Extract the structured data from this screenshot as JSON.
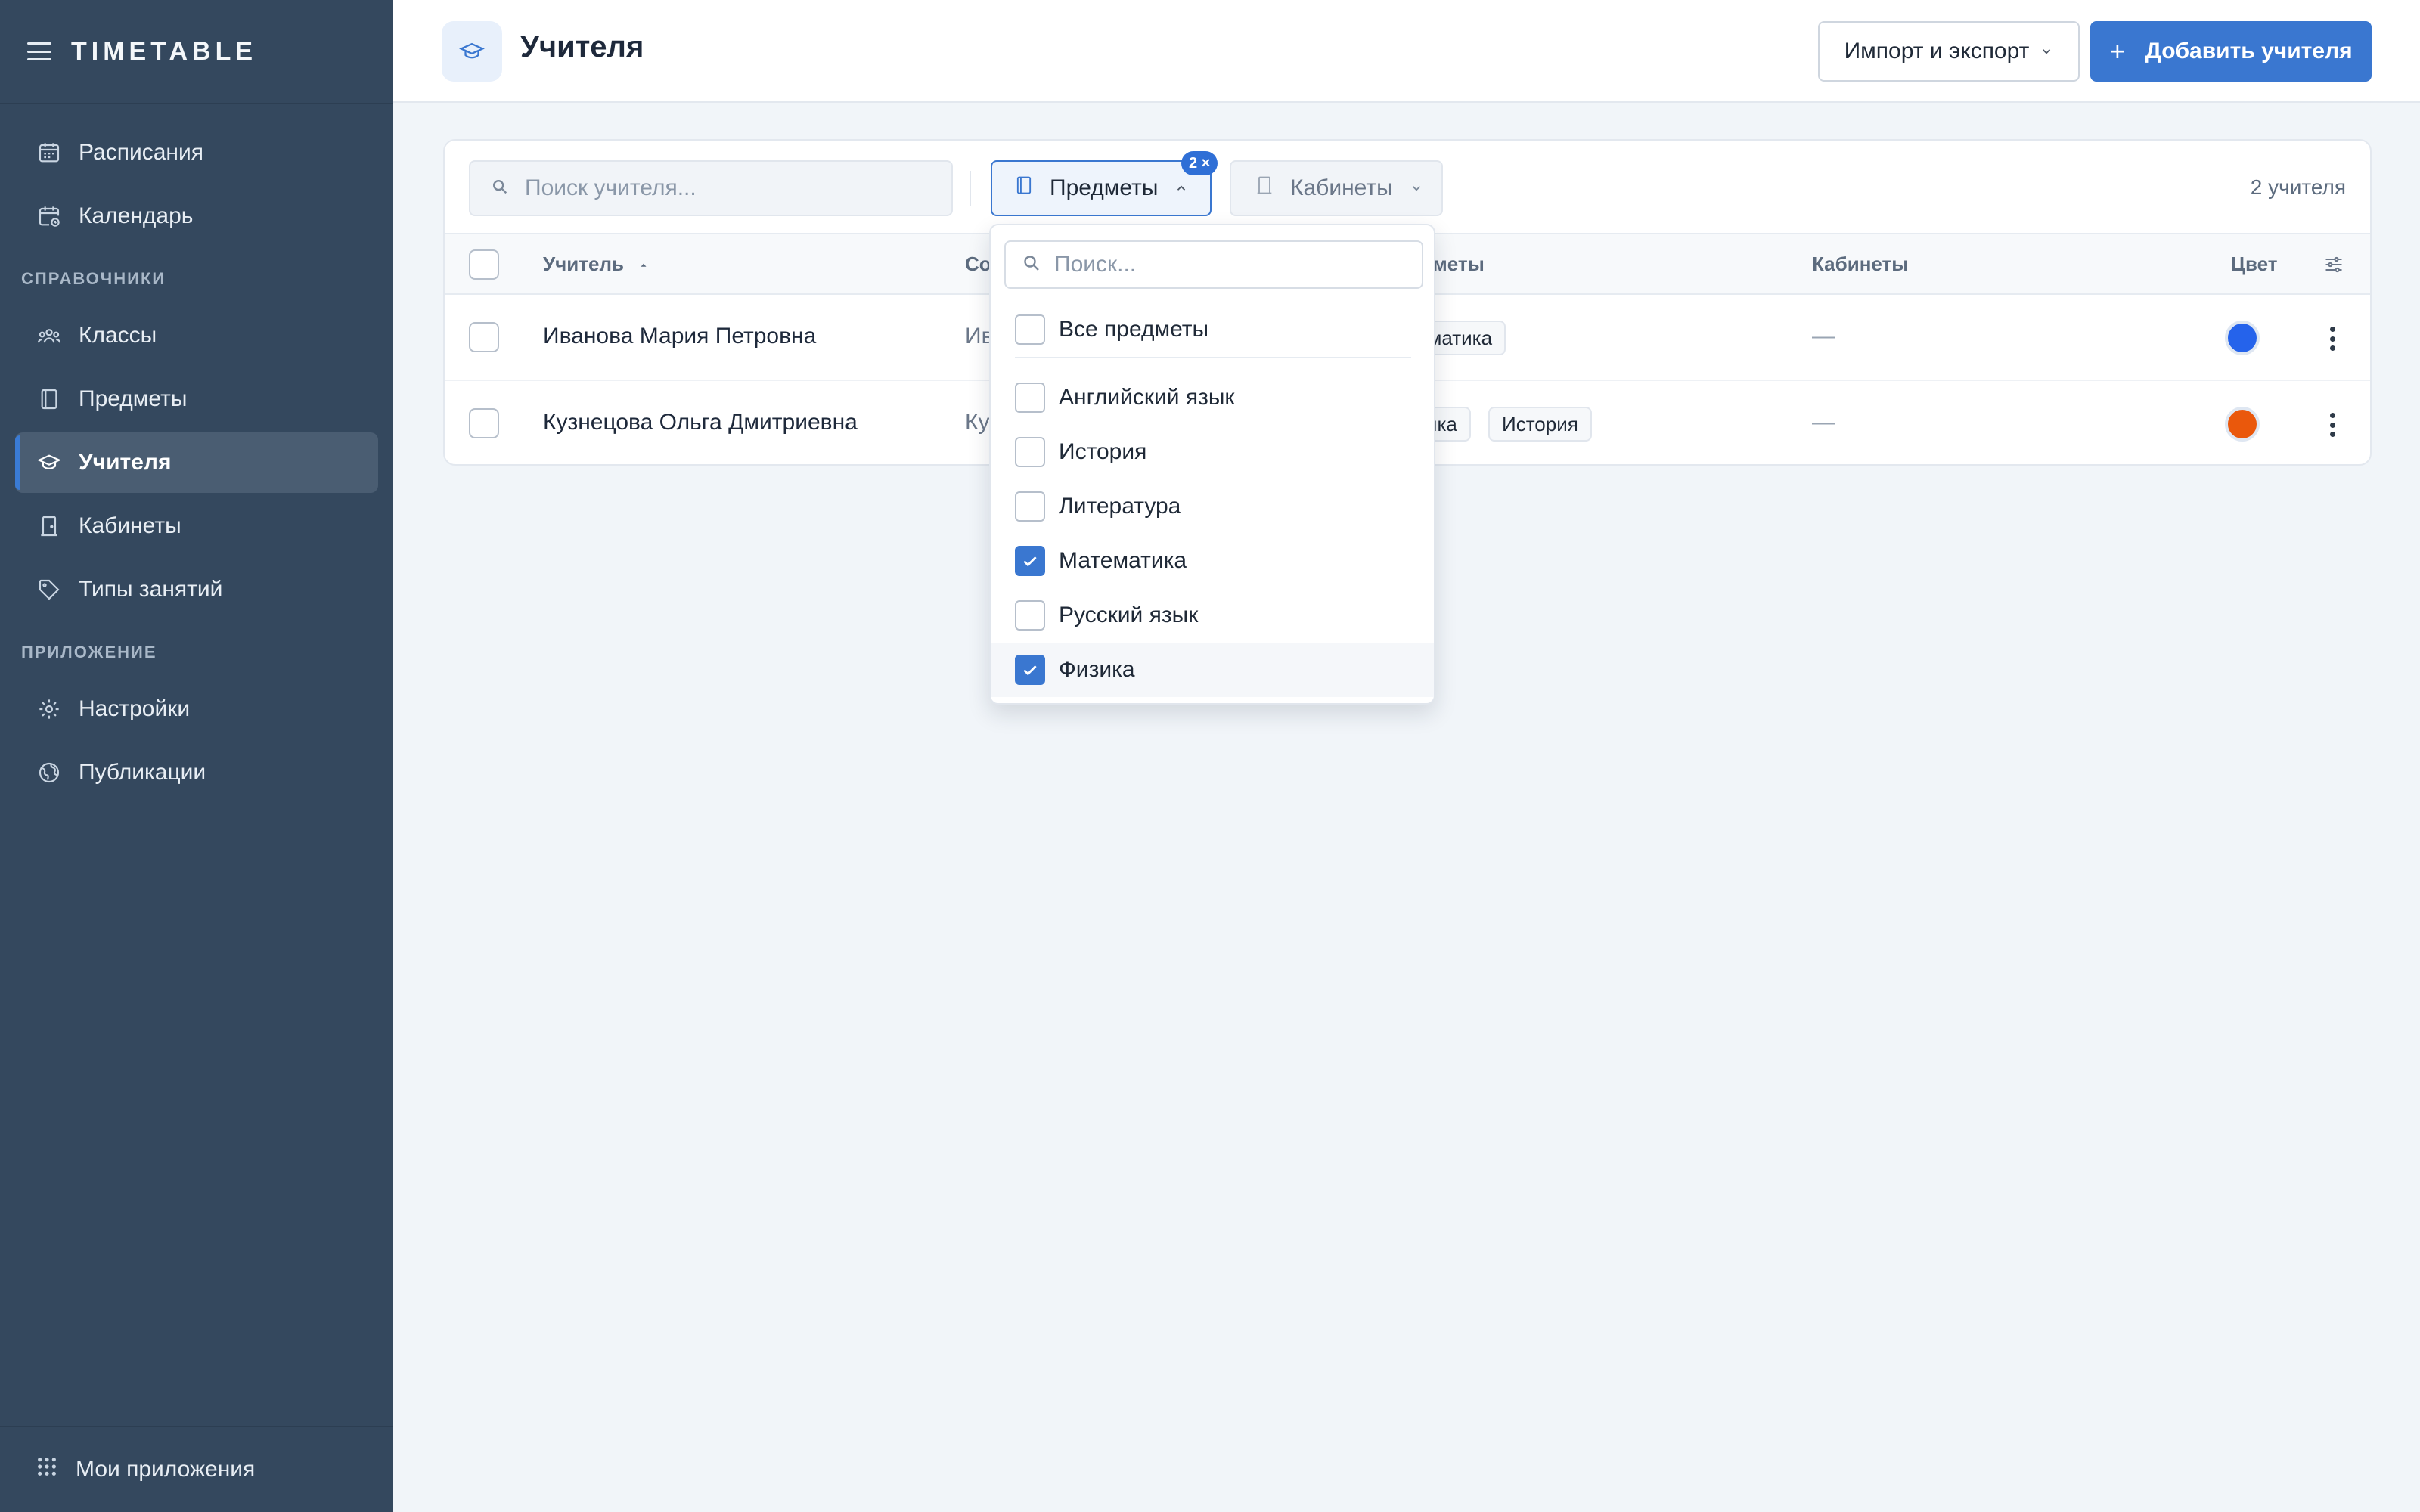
{
  "brand": {
    "name": "TIMETABLE"
  },
  "sidebar": {
    "items_top": [
      {
        "label": "Расписания",
        "icon": "calendar-grid-icon"
      },
      {
        "label": "Календарь",
        "icon": "calendar-clock-icon"
      }
    ],
    "section_refs": "СПРАВОЧНИКИ",
    "items_refs": [
      {
        "label": "Классы",
        "icon": "group-icon"
      },
      {
        "label": "Предметы",
        "icon": "book-icon"
      },
      {
        "label": "Учителя",
        "icon": "graduation-cap-icon",
        "active": true
      },
      {
        "label": "Кабинеты",
        "icon": "door-icon"
      },
      {
        "label": "Типы занятий",
        "icon": "tag-icon"
      }
    ],
    "section_app": "ПРИЛОЖЕНИЕ",
    "items_app": [
      {
        "label": "Настройки",
        "icon": "gear-icon"
      },
      {
        "label": "Публикации",
        "icon": "globe-icon"
      }
    ],
    "bottom": {
      "label": "Мои приложения",
      "icon": "apps-grid-icon"
    }
  },
  "header": {
    "title": "Учителя",
    "import_label": "Импорт и экспорт",
    "add_label": "Добавить учителя"
  },
  "toolbar": {
    "search_placeholder": "Поиск учителя...",
    "subjects_filter": "Предметы",
    "subjects_badge": "2 ×",
    "rooms_filter": "Кабинеты",
    "count": "2 учителя"
  },
  "table": {
    "columns": {
      "teacher": "Учитель",
      "short": "Со",
      "subjects": "дметы",
      "rooms": "Кабинеты",
      "color": "Цвет"
    },
    "rows": [
      {
        "name": "Иванова Мария Петровна",
        "short": "Ив",
        "subjects": [
          "ематика"
        ],
        "rooms": "—",
        "color": "#2563eb"
      },
      {
        "name": "Кузнецова Ольга Дмитриевна",
        "short": "Ку",
        "subjects": [
          "зика",
          "История"
        ],
        "rooms": "—",
        "color": "#ea580c"
      }
    ]
  },
  "dropdown": {
    "search_placeholder": "Поиск...",
    "all_label": "Все предметы",
    "options": [
      {
        "label": "Английский язык",
        "checked": false
      },
      {
        "label": "История",
        "checked": false
      },
      {
        "label": "Литература",
        "checked": false
      },
      {
        "label": "Математика",
        "checked": true
      },
      {
        "label": "Русский язык",
        "checked": false
      },
      {
        "label": "Физика",
        "checked": true
      }
    ]
  },
  "colors": {
    "accent": "#3a77d0",
    "sidebar": "#34485e"
  }
}
